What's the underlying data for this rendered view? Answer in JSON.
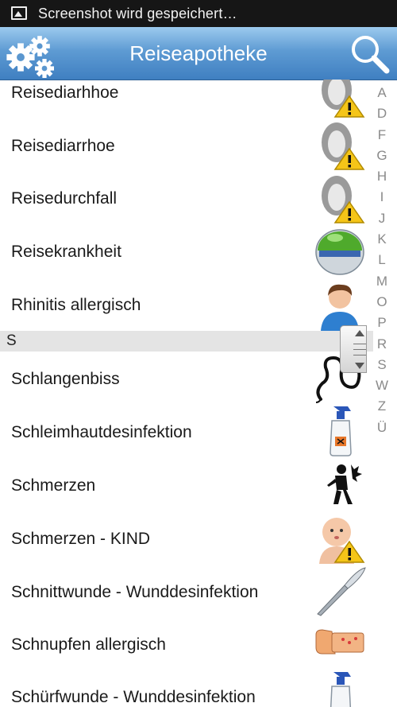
{
  "status_bar": {
    "notification": "Screenshot wird gespeichert…"
  },
  "app_bar": {
    "title": "Reiseapotheke"
  },
  "list": {
    "items": [
      {
        "label": "Reisediarhhoe",
        "icon": "toilet-warning-icon"
      },
      {
        "label": "Reisediarrhoe",
        "icon": "toilet-warning-icon"
      },
      {
        "label": "Reisedurchfall",
        "icon": "toilet-warning-icon"
      },
      {
        "label": "Reisekrankheit",
        "icon": "green-dome-icon"
      },
      {
        "label": "Rhinitis allergisch",
        "icon": "person-icon"
      },
      {
        "label": "Schlangenbiss",
        "icon": "snake-icon"
      },
      {
        "label": "Schleimhautdesinfektion",
        "icon": "spray-bottle-icon"
      },
      {
        "label": "Schmerzen",
        "icon": "pain-figure-icon"
      },
      {
        "label": "Schmerzen - KIND",
        "icon": "baby-warning-icon"
      },
      {
        "label": "Schnittwunde - Wunddesinfektion",
        "icon": "scalpel-icon"
      },
      {
        "label": "Schnupfen allergisch",
        "icon": "allergy-arm-icon"
      },
      {
        "label": "Schürfwunde - Wunddesinfektion",
        "icon": "spray-bottle-icon"
      }
    ],
    "section_header": "S"
  },
  "alphabet_index": [
    "A",
    "D",
    "F",
    "G",
    "H",
    "I",
    "J",
    "K",
    "L",
    "M",
    "O",
    "P",
    "R",
    "S",
    "W",
    "Z",
    "Ü"
  ],
  "colors": {
    "appbar_top": "#9ccaee",
    "appbar_bottom": "#3f7fc1",
    "section_bg": "#e4e4e4",
    "warning": "#f5c518"
  }
}
